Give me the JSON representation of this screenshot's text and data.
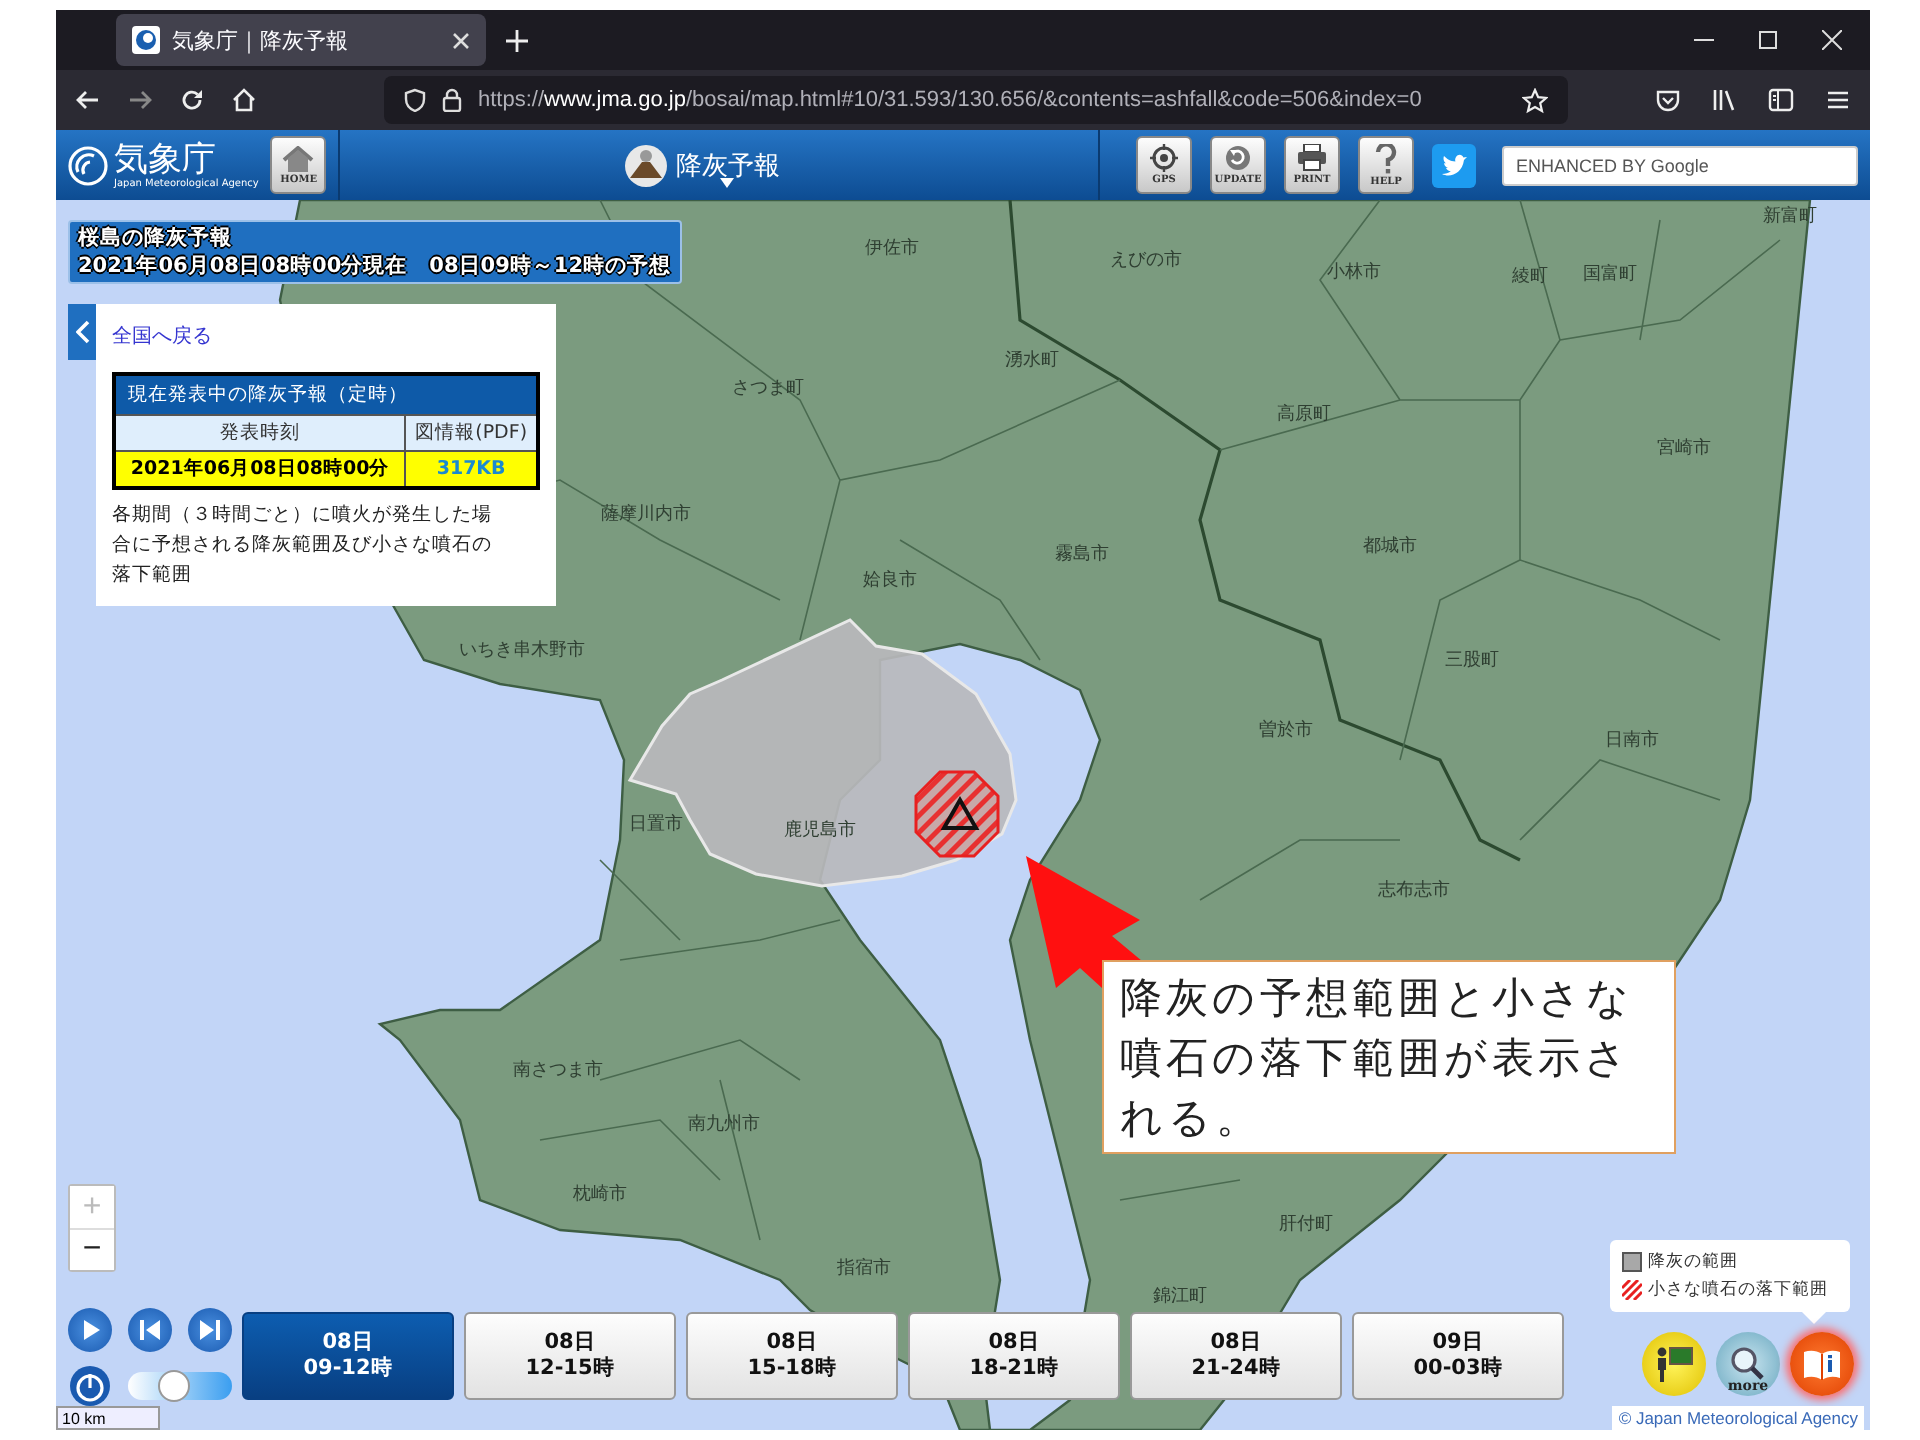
{
  "browser": {
    "tab_title": "気象庁｜降灰予報",
    "url": "https://**www.jma.go.jp**/bosai/map.html#10/31.593/130.656/&contents=ashfall&code=506&index=0"
  },
  "header": {
    "logo_text": "気象庁",
    "logo_subtext": "Japan Meteorological Agency",
    "home_label": "HOME",
    "product_title": "降灰予報",
    "tool_buttons": [
      {
        "kind": "gps",
        "label": "GPS"
      },
      {
        "kind": "update",
        "label": "UPDATE"
      },
      {
        "kind": "print",
        "label": "PRINT"
      },
      {
        "kind": "help",
        "label": "HELP"
      }
    ],
    "search": {
      "placeholder": "ENHANCED BY Google"
    }
  },
  "forecast_title": {
    "title": "桜島の降灰予報",
    "subtitle": "2021年06月08日08時00分現在　08日09時～12時の予想"
  },
  "info_panel": {
    "back_link": "全国へ戻る",
    "table": {
      "caption": "現在発表中の降灰予報（定時）",
      "columns": [
        "発表時刻",
        "図情報(PDF)"
      ],
      "rows": [
        [
          "2021年06月08日08時00分",
          "317KB"
        ]
      ]
    },
    "description": "各期間（３時間ごと）に噴火が発生した場合に予想される降灰範囲及び小さな噴石の落下範囲"
  },
  "map": {
    "labels": [
      "伊佐市",
      "えびの市",
      "小林市",
      "綾町",
      "国富町",
      "新富町",
      "湧水町",
      "さつま町",
      "高原町",
      "宮崎市",
      "薩摩川内市",
      "霧島市",
      "都城市",
      "姶良市",
      "いちき串木野市",
      "三股町",
      "曽於市",
      "日南市",
      "日置市",
      "鹿児島市",
      "志布志市",
      "南さつま市",
      "南九州市",
      "枕崎市",
      "肝付町",
      "指宿市",
      "錦江町"
    ]
  },
  "callout": {
    "text": "降灰の予想範囲と小さな噴石の落下範囲が表示される。"
  },
  "zoom": {
    "zoom_in": {
      "label": "+",
      "disabled": true
    },
    "zoom_out": {
      "label": "−",
      "disabled": false
    }
  },
  "speed_slider": {
    "level": 0.45
  },
  "time_slots": [
    {
      "day": "08日",
      "hours": "09-12時",
      "selected": true
    },
    {
      "day": "08日",
      "hours": "12-15時",
      "selected": false
    },
    {
      "day": "08日",
      "hours": "15-18時",
      "selected": false
    },
    {
      "day": "08日",
      "hours": "18-21時",
      "selected": false
    },
    {
      "day": "08日",
      "hours": "21-24時",
      "selected": false
    },
    {
      "day": "09日",
      "hours": "00-03時",
      "selected": false
    }
  ],
  "legend": {
    "items": [
      {
        "kind": "ash",
        "label": "降灰の範囲"
      },
      {
        "kind": "ballistic",
        "label": "小さな噴石の落下範囲"
      }
    ]
  },
  "more_label": "more",
  "scale_label": "10 km",
  "copyright": "© Japan Meteorological Agency"
}
